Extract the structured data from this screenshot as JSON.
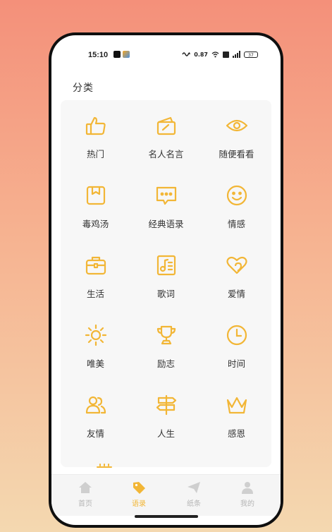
{
  "colors": {
    "accent": "#F2B636",
    "inactive": "#B5B5B5"
  },
  "status": {
    "time": "15:10",
    "left_icons": [
      "app-icon",
      "app-icon"
    ],
    "right_icons": [
      "nfc-icon",
      "speed-icon",
      "wifi-icon",
      "hd-icon",
      "signal-icon",
      "battery-icon"
    ],
    "speed": "0.87",
    "battery": "37"
  },
  "page": {
    "title": "分类"
  },
  "categories": [
    {
      "label": "热门",
      "icon": "thumbs-up-icon"
    },
    {
      "label": "名人名言",
      "icon": "card-icon"
    },
    {
      "label": "随便看看",
      "icon": "eye-icon"
    },
    {
      "label": "毒鸡汤",
      "icon": "box-icon"
    },
    {
      "label": "经典语录",
      "icon": "chat-icon"
    },
    {
      "label": "情感",
      "icon": "smile-icon"
    },
    {
      "label": "生活",
      "icon": "briefcase-icon"
    },
    {
      "label": "歌词",
      "icon": "music-icon"
    },
    {
      "label": "爱情",
      "icon": "hearts-icon"
    },
    {
      "label": "唯美",
      "icon": "sun-icon"
    },
    {
      "label": "励志",
      "icon": "trophy-icon"
    },
    {
      "label": "时间",
      "icon": "clock-icon"
    },
    {
      "label": "友情",
      "icon": "friends-icon"
    },
    {
      "label": "人生",
      "icon": "signpost-icon"
    },
    {
      "label": "感恩",
      "icon": "crown-icon"
    }
  ],
  "tabs": [
    {
      "label": "首页",
      "icon": "home-icon",
      "active": false
    },
    {
      "label": "语录",
      "icon": "tag-icon",
      "active": true
    },
    {
      "label": "纸条",
      "icon": "paper-plane-icon",
      "active": false
    },
    {
      "label": "我的",
      "icon": "user-icon",
      "active": false
    }
  ]
}
